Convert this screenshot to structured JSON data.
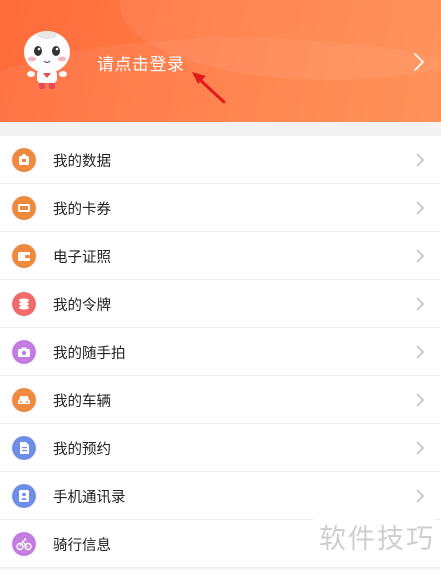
{
  "header": {
    "login_label": "请点击登录",
    "gradient_start": "#ff6b3a",
    "gradient_end": "#ff8c50"
  },
  "menu": {
    "items": [
      {
        "label": "我的数据",
        "icon": "data-icon",
        "color": "#f0883e"
      },
      {
        "label": "我的卡券",
        "icon": "coupon-icon",
        "color": "#f0883e"
      },
      {
        "label": "电子证照",
        "icon": "wallet-icon",
        "color": "#f0883e"
      },
      {
        "label": "我的令牌",
        "icon": "token-icon",
        "color": "#ef6b6b"
      },
      {
        "label": "我的随手拍",
        "icon": "camera-icon",
        "color": "#c47ee0"
      },
      {
        "label": "我的车辆",
        "icon": "car-icon",
        "color": "#f0883e"
      },
      {
        "label": "我的预约",
        "icon": "document-icon",
        "color": "#6f8ee8"
      },
      {
        "label": "手机通讯录",
        "icon": "contacts-icon",
        "color": "#6f8ee8"
      },
      {
        "label": "骑行信息",
        "icon": "bicycle-icon",
        "color": "#c47ee0"
      }
    ]
  },
  "watermark": "软件技巧"
}
